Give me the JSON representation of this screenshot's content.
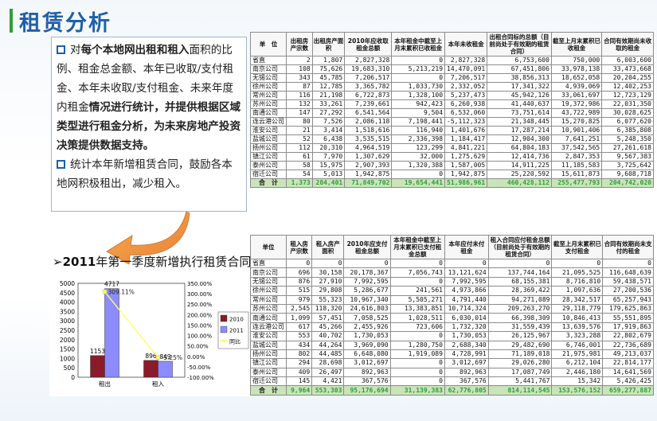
{
  "title": "租赁分析",
  "text": {
    "p1_prefix": "对",
    "p1_b1": "每个本地网出租和租入",
    "p1_mid1": "面积的比例、租金总金额、本年已收取/支付租金、本年未收取/支付租金、未来年度内租金",
    "p1_b2": "情况进行统计，并提供根据区域类型进行租金分析，为未来房地产投资决策提供数据支持。",
    "p2": "统计本年新增租赁合同，鼓励各本地网积极租出，减少租入。"
  },
  "chart_label_year": "2011",
  "chart_label_rest": "年第一季度新增执行租赁合同:",
  "colors": {
    "s2010": "#8b1a2b",
    "s2011": "#8c8cff",
    "ratio": "#ffff66"
  },
  "chart_data": {
    "type": "bar",
    "categories": [
      "租出",
      "租入"
    ],
    "series": [
      {
        "name": "2010",
        "values": [
          1153,
          896
        ]
      },
      {
        "name": "2011",
        "values": [
          4717,
          849
        ]
      }
    ],
    "ratio_series": {
      "name": "同比",
      "values": [
        309.11,
        -5.25
      ],
      "labels": [
        "309.11%",
        "-5.25%"
      ]
    },
    "ylim": [
      0,
      5000
    ],
    "yticks": [
      "5000",
      "4500",
      "4000",
      "3500",
      "3000",
      "2500",
      "2000",
      "1500",
      "1000",
      "500",
      "0"
    ],
    "y2lim": [
      -100,
      350
    ],
    "y2ticks": [
      "350.00%",
      "300.00%",
      "250.00%",
      "200.00%",
      "150.00%",
      "100.00%",
      "50.00%",
      "0.00%",
      "-50.00%",
      "-100.00%"
    ],
    "bar_labels": [
      "4717",
      "1153",
      "896",
      "849"
    ],
    "legend": [
      "2010",
      "2011",
      "同比"
    ],
    "legend_position": "right"
  },
  "table1": {
    "headers": [
      "单　位",
      "出租房产宗数",
      "出租房产面积",
      "2010年应收取租金总额",
      "本年租金中截至上月末累积已收租金",
      "本年未收租金",
      "出租合同标的总额（目前尚处于有效期的租赁合同）",
      "截至上月末累积已收租金",
      "合同有效期尚未收取的租金"
    ],
    "rows": [
      [
        "省直",
        "2",
        "1,807",
        "2,827,328",
        "0",
        "2,827,328",
        "6,753,600",
        "750,000",
        "6,003,600"
      ],
      [
        "南京公司",
        "108",
        "75,626",
        "19,683,310",
        "5,213,219",
        "14,470,091",
        "67,451,806",
        "33,978,138",
        "33,473,668"
      ],
      [
        "无锡公司",
        "343",
        "45,785",
        "7,206,517",
        "0",
        "7,206,517",
        "38,856,313",
        "18,652,058",
        "20,204,255"
      ],
      [
        "徐州公司",
        "87",
        "12,785",
        "3,365,782",
        "1,033,730",
        "2,332,052",
        "17,341,322",
        "4,939,069",
        "12,402,253"
      ],
      [
        "常州公司",
        "116",
        "21,198",
        "6,722,873",
        "1,328,100",
        "5,237,473",
        "45,942,126",
        "33,061,697",
        "12,723,129"
      ],
      [
        "苏州公司",
        "132",
        "33,261",
        "7,239,661",
        "942,423",
        "6,260,938",
        "41,440,637",
        "19,372,986",
        "22,031,350"
      ],
      [
        "南通公司",
        "147",
        "27,292",
        "6,541,564",
        "9,504",
        "6,532,060",
        "73,751,614",
        "43,722,989",
        "30,028,625"
      ],
      [
        "连云港公司",
        "80",
        "7,526",
        "2,086,118",
        "7,198,441",
        "-5,112,323",
        "21,348,445",
        "15,270,825",
        "6,077,620"
      ],
      [
        "淮安公司",
        "21",
        "3,414",
        "1,518,616",
        "116,940",
        "1,401,676",
        "17,287,214",
        "10,901,406",
        "6,385,808"
      ],
      [
        "盐城公司",
        "52",
        "6,438",
        "3,535,515",
        "2,336,398",
        "1,184,417",
        "12,904,300",
        "7,641,251",
        "5,248,350"
      ],
      [
        "扬州公司",
        "112",
        "20,310",
        "4,964,519",
        "123,299",
        "4,841,221",
        "64,804,183",
        "37,542,565",
        "27,261,618"
      ],
      [
        "镇江公司",
        "61",
        "7,970",
        "1,307,629",
        "32,000",
        "1,275,629",
        "12,414,736",
        "2,847,353",
        "9,567,383"
      ],
      [
        "泰州公司",
        "58",
        "15,975",
        "2,907,393",
        "1,320,388",
        "1,587,005",
        "14,911,225",
        "11,185,583",
        "3,725,642"
      ],
      [
        "宿迁公司",
        "54",
        "5,013",
        "1,942,875",
        "0",
        "1,942,875",
        "25,220,592",
        "15,611,873",
        "9,608,718"
      ]
    ],
    "total": [
      "合　计",
      "1,373",
      "284,401",
      "71,849,702",
      "19,654,441",
      "51,986,961",
      "460,428,112",
      "255,477,793",
      "204,742,020"
    ]
  },
  "table2": {
    "headers": [
      "单位",
      "租入房产宗数",
      "租入房产面积",
      "2010年应支付租金总额",
      "本年租金中截至上月末累积已支付租金总额",
      "本年应付未付租金",
      "租入合同应付租金总额（目前尚处于有效期的租赁合同）",
      "截至上月末累积已支付租金",
      "合同有效期尚未支付的租金"
    ],
    "rows": [
      [
        "省直",
        "0",
        "0",
        "0",
        "0",
        "0",
        "0",
        "0",
        "0"
      ],
      [
        "南京公司",
        "696",
        "30,158",
        "20,178,367",
        "7,056,743",
        "13,121,624",
        "137,744,164",
        "21,095,525",
        "116,648,639"
      ],
      [
        "无锡公司",
        "876",
        "27,910",
        "7,992,595",
        "0",
        "7,992,595",
        "68,155,381",
        "8,716,810",
        "59,438,571"
      ],
      [
        "徐州公司",
        "515",
        "29,808",
        "5,286,677",
        "241,561",
        "4,973,866",
        "28,369,422",
        "1,097,636",
        "27,200,536"
      ],
      [
        "常州公司",
        "979",
        "55,323",
        "10,967,340",
        "5,505,271",
        "4,791,440",
        "94,271,089",
        "28,342,517",
        "65,257,943"
      ],
      [
        "苏州公司",
        "2,545",
        "118,320",
        "24,616,803",
        "13,383,851",
        "10,714,324",
        "209,263,270",
        "29,118,779",
        "179,625,863"
      ],
      [
        "南通公司",
        "1,099",
        "57,451",
        "7,058,525",
        "1,028,511",
        "6,030,014",
        "66,398,309",
        "10,846,413",
        "55,551,895"
      ],
      [
        "连云港公司",
        "617",
        "45,266",
        "2,455,926",
        "723,606",
        "1,732,320",
        "31,559,439",
        "13,639,576",
        "17,919,863"
      ],
      [
        "淮安公司",
        "553",
        "40,702",
        "1,730,053",
        "0",
        "1,730,053",
        "26,125,967",
        "3,323,288",
        "22,802,679"
      ],
      [
        "盐城公司",
        "434",
        "44,264",
        "3,969,090",
        "1,280,750",
        "2,688,340",
        "29,482,690",
        "6,746,001",
        "22,736,689"
      ],
      [
        "扬州公司",
        "802",
        "44,485",
        "6,648,080",
        "1,919,089",
        "4,728,991",
        "71,189,018",
        "21,975,981",
        "49,213,037"
      ],
      [
        "镇江公司",
        "294",
        "28,698",
        "3,012,697",
        "0",
        "3,012,697",
        "29,026,280",
        "6,212,104",
        "22,814,177"
      ],
      [
        "泰州公司",
        "409",
        "26,497",
        "892,963",
        "0",
        "892,963",
        "17,087,749",
        "2,446,180",
        "14,641,569"
      ],
      [
        "宿迁公司",
        "145",
        "4,421",
        "367,576",
        "0",
        "367,576",
        "5,441,767",
        "15,342",
        "5,426,425"
      ]
    ],
    "total": [
      "合　计",
      "9,964",
      "553,303",
      "95,176,694",
      "31,139,383",
      "62,776,805",
      "814,114,545",
      "153,576,152",
      "659,277,887"
    ]
  }
}
